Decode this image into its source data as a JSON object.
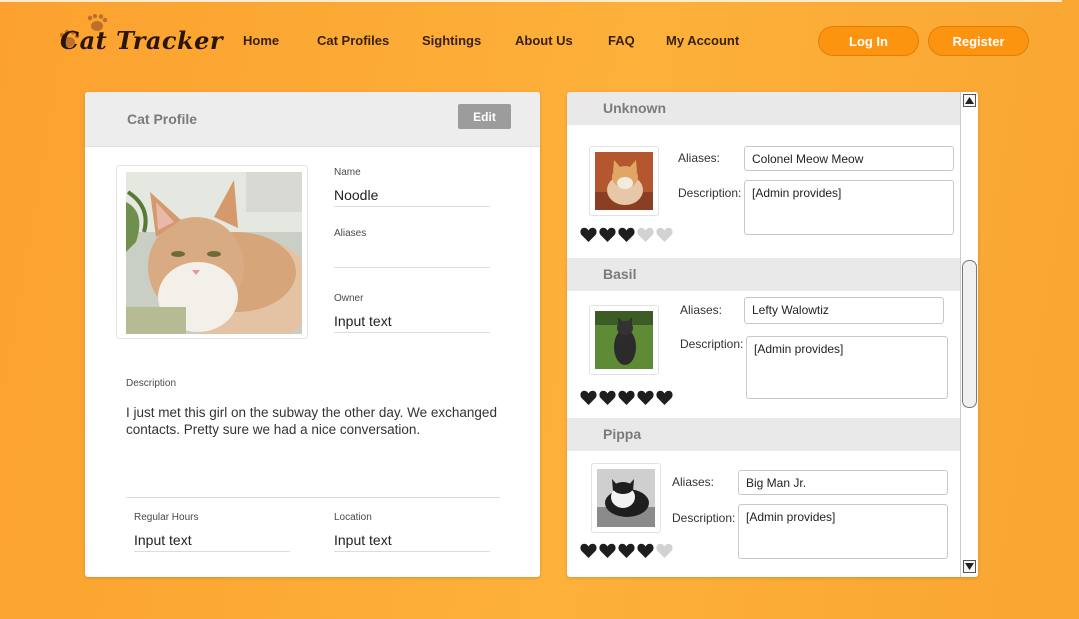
{
  "brand": {
    "name": "Cat Tracker",
    "logo_icon": "paw-prints-icon"
  },
  "nav": {
    "links": [
      "Home",
      "Cat Profiles",
      "Sightings",
      "About Us",
      "FAQ",
      "My Account"
    ],
    "login": "Log In",
    "register": "Register"
  },
  "colors": {
    "accent": "#fd9410",
    "background": "#fca12f",
    "heart_filled": "#1e1e1e",
    "heart_empty": "#d2d2d2"
  },
  "profile": {
    "title": "Cat Profile",
    "edit": "Edit",
    "name_label": "Name",
    "name_value": "Noodle",
    "aliases_label": "Aliases",
    "aliases_value": "",
    "owner_label": "Owner",
    "owner_value": "Input text",
    "description_label": "Description",
    "description_value": "I just met this girl on the subway the other day. We exchanged contacts. Pretty sure we had a nice conversation.",
    "hours_label": "Regular Hours",
    "hours_value": "Input text",
    "location_label": "Location",
    "location_value": "Input text"
  },
  "sightings": [
    {
      "name": "Unknown",
      "aliases_label": "Aliases:",
      "aliases": "Colonel Meow Meow",
      "description_label": "Description:",
      "description": "[Admin provides]",
      "rating": 3,
      "max": 5
    },
    {
      "name": "Basil",
      "aliases_label": "Aliases:",
      "aliases": "Lefty Walowtiz",
      "description_label": "Description:",
      "description": "[Admin provides]",
      "rating": 5,
      "max": 5
    },
    {
      "name": "Pippa",
      "aliases_label": "Aliases:",
      "aliases": "Big Man Jr.",
      "description_label": "Description:",
      "description": "[Admin provides]",
      "rating": 4,
      "max": 5
    }
  ]
}
